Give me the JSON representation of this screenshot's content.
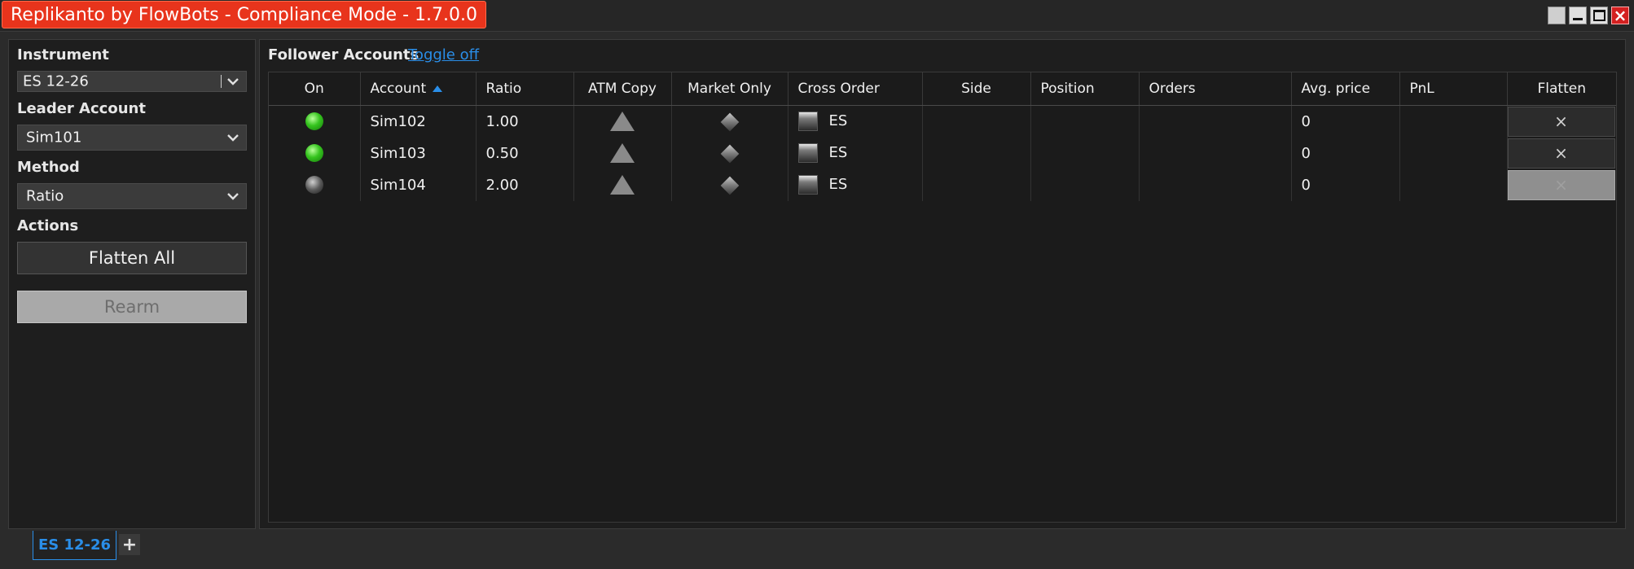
{
  "window": {
    "title": "Replikanto by FlowBots - Compliance Mode - 1.7.0.0",
    "close_glyph": "×"
  },
  "sidebar": {
    "instrument_label": "Instrument",
    "instrument_value": "ES 12-26",
    "leader_label": "Leader Account",
    "leader_value": "Sim101",
    "method_label": "Method",
    "method_value": "Ratio",
    "actions_label": "Actions",
    "flatten_all_label": "Flatten All",
    "rearm_label": "Rearm"
  },
  "followers": {
    "title": "Follower Accounts",
    "toggle_label": "Toggle off",
    "columns": [
      "On",
      "Account",
      "Ratio",
      "ATM Copy",
      "Market Only",
      "Cross Order",
      "Side",
      "Position",
      "Orders",
      "Avg. price",
      "PnL",
      "Flatten"
    ],
    "flatten_glyph": "×",
    "rows": [
      {
        "on": true,
        "account": "Sim102",
        "ratio": "1.00",
        "cross_order": "ES",
        "side": "",
        "position": "",
        "orders": "",
        "avg_price": "0",
        "pnl": "",
        "flatten_enabled": true
      },
      {
        "on": true,
        "account": "Sim103",
        "ratio": "0.50",
        "cross_order": "ES",
        "side": "",
        "position": "",
        "orders": "",
        "avg_price": "0",
        "pnl": "",
        "flatten_enabled": true
      },
      {
        "on": false,
        "account": "Sim104",
        "ratio": "2.00",
        "cross_order": "ES",
        "side": "",
        "position": "",
        "orders": "",
        "avg_price": "0",
        "pnl": "",
        "flatten_enabled": false
      }
    ]
  },
  "tabs": {
    "items": [
      {
        "label": "ES 12-26"
      }
    ],
    "add_label": "+"
  },
  "colors": {
    "title_bg": "#e8341c",
    "accent": "#2a8ee8",
    "led_on": "#35c41e",
    "panel_bg": "#1e1e1e"
  }
}
